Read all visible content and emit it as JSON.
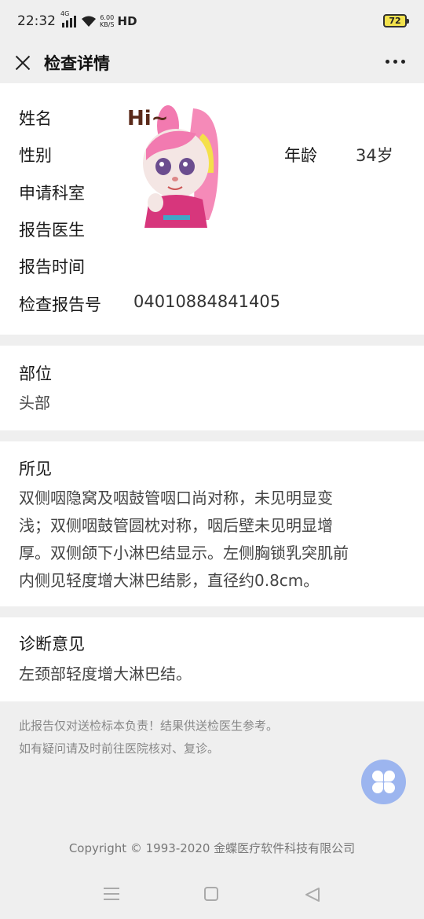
{
  "status_bar": {
    "time": "22:32",
    "network_type": "4G",
    "speed_value": "6.00",
    "speed_unit": "KB/S",
    "hd": "HD",
    "battery": "72"
  },
  "header": {
    "title": "检查详情"
  },
  "patient": {
    "name_label": "姓名",
    "gender_label": "性别",
    "age_label": "年龄",
    "age_value": "34岁",
    "department_label": "申请科室",
    "doctor_label": "报告医生",
    "time_label": "报告时间",
    "report_no_label": "检查报告号",
    "report_no_value": "04010884841405",
    "avatar_text": "Hi~"
  },
  "site": {
    "title": "部位",
    "value": "头部"
  },
  "findings": {
    "title": "所见",
    "lines": [
      "双侧咽隐窝及咽鼓管咽口尚对称，未见明显变",
      "浅；双侧咽鼓管圆枕对称，咽后壁未见明显增",
      "厚。双侧颌下小淋巴结显示。左侧胸锁乳突肌前",
      "内侧见轻度增大淋巴结影，直径约0.8cm。"
    ]
  },
  "diagnosis": {
    "title": "诊断意见",
    "value": "左颈部轻度增大淋巴结。"
  },
  "notes": {
    "line1": "此报告仅对送检标本负责！结果供送检医生参考。",
    "line2": "如有疑问请及时前往医院核对、复诊。"
  },
  "copyright": "Copyright © 1993-2020 金蝶医疗软件科技有限公司",
  "colors": {
    "fab": "#9cb5ef",
    "battery": "#f2e24d"
  },
  "icons": {
    "close": "close-icon",
    "more": "more-dots-icon",
    "fab": "clover-menu-icon",
    "nav_menu": "menu-lines-icon",
    "nav_home": "square-home-icon",
    "nav_back": "triangle-back-icon"
  }
}
